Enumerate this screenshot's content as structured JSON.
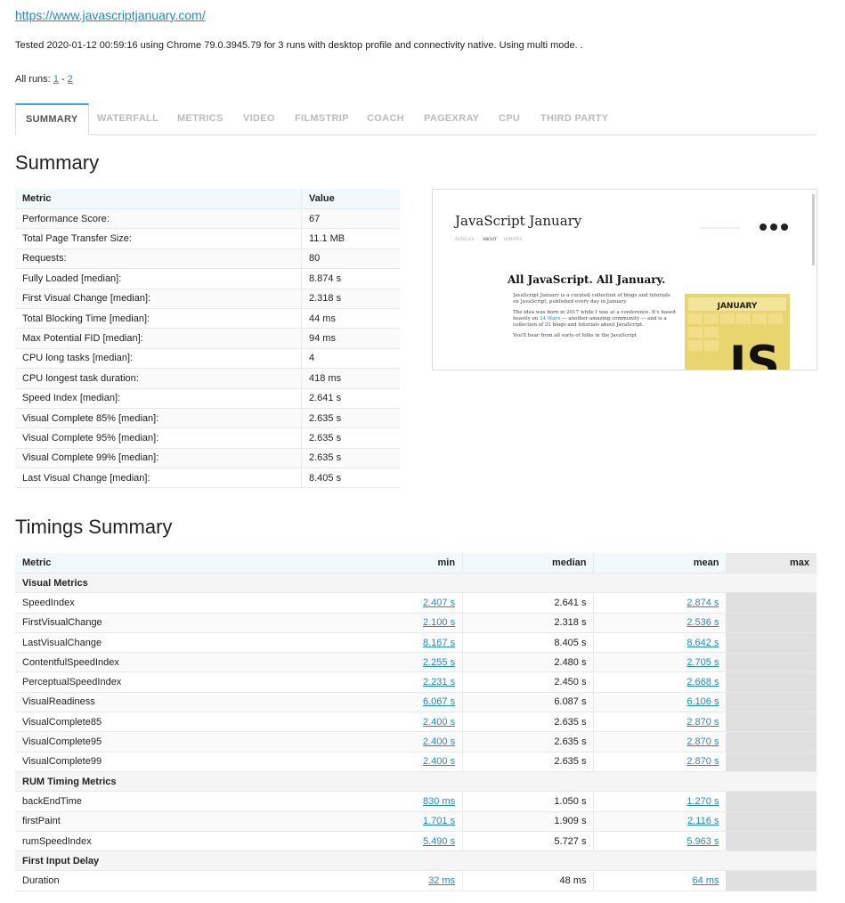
{
  "url": "https://www.javascriptjanuary.com/",
  "tested_line": "Tested 2020-01-12 00:59:16 using Chrome 79.0.3945.79 for 3 runs with desktop profile and connectivity native. Using multi mode.  .",
  "all_runs": {
    "label": "All runs:",
    "run1": "1",
    "sep": "-",
    "run2": "2"
  },
  "tabs": [
    "SUMMARY",
    "WATERFALL",
    "METRICS",
    "VIDEO",
    "FILMSTRIP",
    "COACH",
    "PAGEXRAY",
    "CPU",
    "THIRD PARTY"
  ],
  "summary": {
    "heading": "Summary",
    "headers": [
      "Metric",
      "Value"
    ],
    "rows": [
      [
        "Performance Score:",
        "67"
      ],
      [
        "Total Page Transfer Size:",
        "11.1 MB"
      ],
      [
        "Requests:",
        "80"
      ],
      [
        "Fully Loaded [median]:",
        "8.874 s"
      ],
      [
        "First Visual Change [median]:",
        "2.318 s"
      ],
      [
        "Total Blocking Time [median]:",
        "44 ms"
      ],
      [
        "Max Potential FID [median]:",
        "94 ms"
      ],
      [
        "CPU long tasks [median]:",
        "4"
      ],
      [
        "CPU longest task duration:",
        "418 ms"
      ],
      [
        "Speed Index [median]:",
        "2.641 s"
      ],
      [
        "Visual Complete 85% [median]:",
        "2.635 s"
      ],
      [
        "Visual Complete 95% [median]:",
        "2.635 s"
      ],
      [
        "Visual Complete 99% [median]:",
        "2.635 s"
      ],
      [
        "Last Visual Change [median]:",
        "8.405 s"
      ]
    ]
  },
  "screenshot": {
    "site_title": "JavaScript January",
    "nav": [
      "ARTICLES",
      "ABOUT",
      "UPDATES"
    ],
    "headline": "All JavaScript. All January.",
    "para1": "JavaScript January is a curated collection of blogs and tutorials on JavaScript, published every day in January.",
    "para2_a": "The idea was born in 2017 while I was at a conference. It's based heavily on ",
    "para2_link": "24 Ways",
    "para2_b": " — another amazing community — and is a collection of 31 blogs and tutorials about JavaScript.",
    "para3": "You'll hear from all sorts of folks in the JavaScript",
    "calendar_label": "JANUARY",
    "calendar_big": "JS",
    "brand_color": "#e8d56e"
  },
  "timings": {
    "heading": "Timings Summary",
    "headers": [
      "Metric",
      "min",
      "median",
      "mean",
      "max"
    ],
    "groups": [
      {
        "name": "Visual Metrics",
        "rows": [
          [
            "SpeedIndex",
            "2.407 s",
            "2.641 s",
            "2.874 s"
          ],
          [
            "FirstVisualChange",
            "2.100 s",
            "2.318 s",
            "2.536 s"
          ],
          [
            "LastVisualChange",
            "8.167 s",
            "8.405 s",
            "8.642 s"
          ],
          [
            "ContentfulSpeedIndex",
            "2.255 s",
            "2.480 s",
            "2.705 s"
          ],
          [
            "PerceptualSpeedIndex",
            "2.231 s",
            "2.450 s",
            "2.668 s"
          ],
          [
            "VisualReadiness",
            "6.067 s",
            "6.087 s",
            "6.106 s"
          ],
          [
            "VisualComplete85",
            "2.400 s",
            "2.635 s",
            "2.870 s"
          ],
          [
            "VisualComplete95",
            "2.400 s",
            "2.635 s",
            "2.870 s"
          ],
          [
            "VisualComplete99",
            "2.400 s",
            "2.635 s",
            "2.870 s"
          ]
        ]
      },
      {
        "name": "RUM Timing Metrics",
        "rows": [
          [
            "backEndTime",
            "830 ms",
            "1.050 s",
            "1.270 s"
          ],
          [
            "firstPaint",
            "1.701 s",
            "1.909 s",
            "2.116 s"
          ],
          [
            "rumSpeedIndex",
            "5.490 s",
            "5.727 s",
            "5.963 s"
          ]
        ]
      },
      {
        "name": "First Input Delay",
        "rows": [
          [
            "Duration",
            "32 ms",
            "48 ms",
            "64 ms"
          ]
        ]
      }
    ]
  }
}
